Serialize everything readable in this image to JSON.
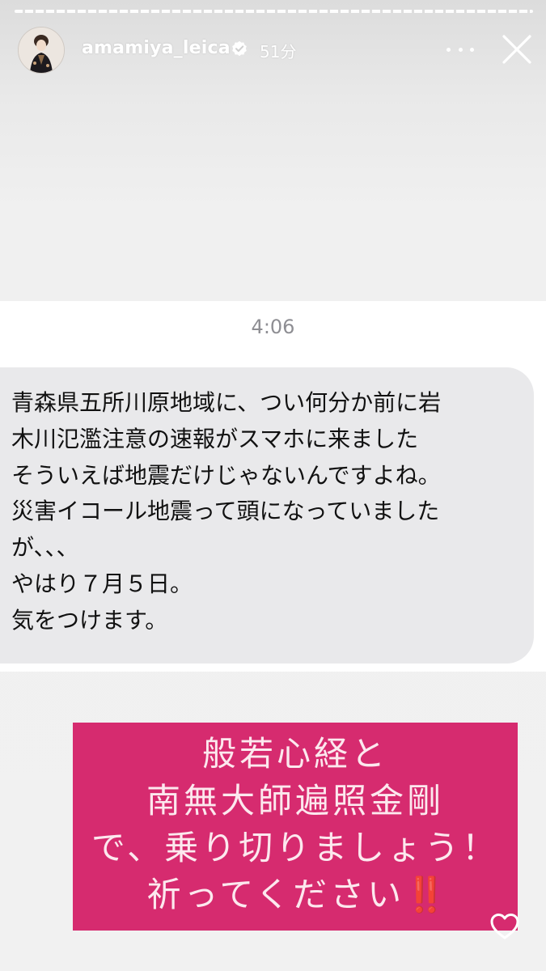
{
  "story": {
    "username": "amamiya_leica",
    "time_ago": "51分",
    "segments": 46
  },
  "message": {
    "time": "4:06",
    "lines": [
      "青森県五所川原地域に、つい何分か前に岩",
      "木川氾濫注意の速報がスマホに来ました",
      "そういえば地震だけじゃないんですよね。",
      "災害イコール地震って頭になっていました",
      "が、、、",
      "やはり７月５日。",
      "気をつけます。"
    ]
  },
  "banner": {
    "lines": [
      "般若心経と",
      "南無大師遍照金剛",
      "で、乗り切りましょう！",
      "祈ってください"
    ],
    "emphasis": "‼️",
    "color": "#d62b6f"
  },
  "icons": {
    "verified": "verified-badge-icon",
    "more": "more-options-icon",
    "close": "close-icon",
    "like": "heart-icon"
  }
}
